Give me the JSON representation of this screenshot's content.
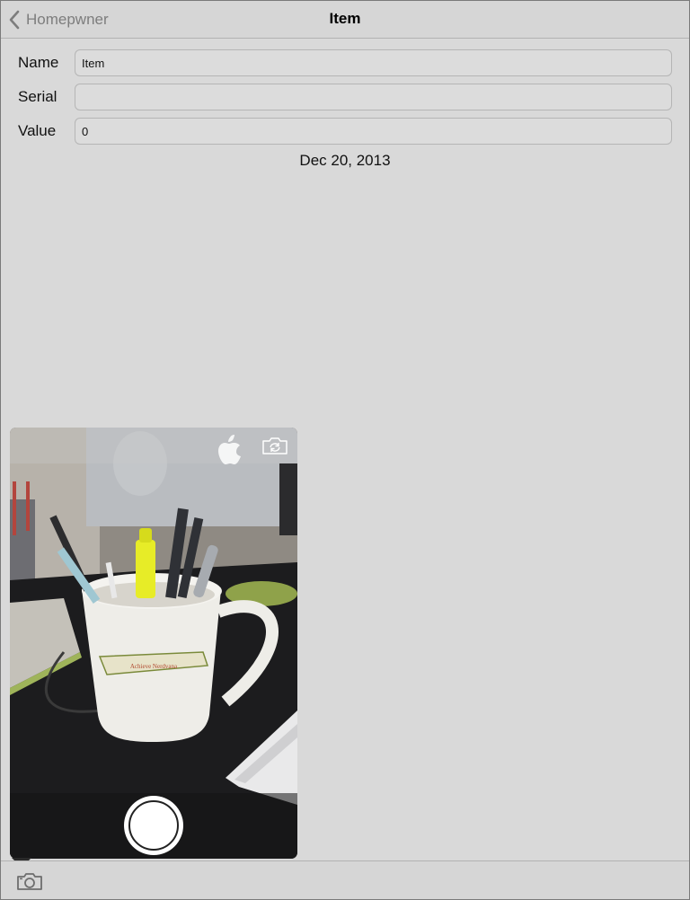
{
  "nav": {
    "back_label": "Homepwner",
    "title": "Item"
  },
  "form": {
    "name_label": "Name",
    "name_value": "Item",
    "serial_label": "Serial",
    "serial_value": "",
    "value_label": "Value",
    "value_value": "0"
  },
  "date_created": "Dec 20, 2013",
  "camera": {
    "flip_icon": "camera-flip-icon",
    "shutter_icon": "shutter-button"
  },
  "toolbar": {
    "camera_icon": "camera-icon"
  },
  "colors": {
    "background": "#d9d9d9",
    "bar": "#d6d6d6",
    "back_label": "#7d7d7d"
  }
}
